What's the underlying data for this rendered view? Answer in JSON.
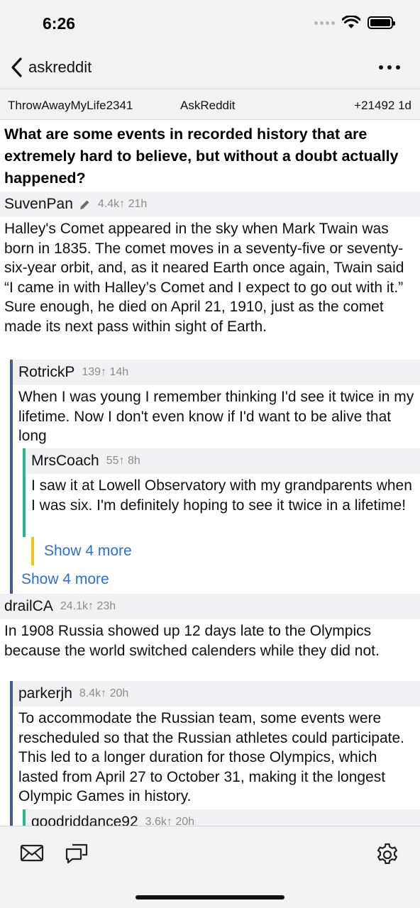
{
  "status": {
    "time": "6:26"
  },
  "nav": {
    "title": "askreddit"
  },
  "post": {
    "author": "ThrowAwayMyLife2341",
    "subreddit": "AskReddit",
    "score_age": "+21492  1d",
    "title": "What are some events in recorded history that are extremely hard to believe, but without a doubt actually happened?"
  },
  "comments": [
    {
      "user": "SuvenPan",
      "meta": "4.4k↑  21h",
      "body": "Halley's Comet appeared in the sky when Mark Twain was born in 1835. The comet moves in a seventy-five or seventy-six-year orbit, and, as it neared Earth once again, Twain said “I came in with Halley’s Comet and I expect to go out with it.” Sure enough, he died on April 21, 1910, just as the comet made its next pass within sight of Earth.",
      "replies": [
        {
          "user": "RotrickP",
          "meta": "139↑  14h",
          "body": "When I was young I remember thinking I'd see it twice in my lifetime. Now I don't even know if I'd want to be alive that long",
          "replies": [
            {
              "user": "MrsCoach",
              "meta": "55↑  8h",
              "body": "I saw it at Lowell Observatory with my grandparents when I was six.  I'm definitely hoping to see it twice in a lifetime!",
              "show_more": "Show 4 more"
            }
          ]
        }
      ],
      "show_more": "Show 4 more"
    },
    {
      "user": "drailCA",
      "meta": "24.1k↑  23h",
      "body": "In 1908 Russia showed up 12 days late to the Olympics because the world switched calenders while they did not.",
      "replies": [
        {
          "user": "parkerjh",
          "meta": "8.4k↑  20h",
          "body": "To accommodate the Russian team, some events were rescheduled so that the Russian athletes could participate. This led to a longer duration for those Olympics, which lasted from April 27 to October 31, making it the longest Olympic Games in history.",
          "replies": [
            {
              "user": "goodriddance92",
              "meta": "3.6k↑  20h"
            }
          ]
        }
      ]
    }
  ],
  "icons": {
    "back": "chevron-left-icon",
    "more": "ellipsis-icon",
    "edit": "pencil-icon",
    "inbox": "envelope-icon",
    "chat": "chat-bubbles-icon",
    "settings": "gear-icon"
  },
  "colors": {
    "depth1": "#4a5a8f",
    "depth2": "#2bb592",
    "depth3": "#f2c417",
    "link": "#2f6fd0"
  }
}
